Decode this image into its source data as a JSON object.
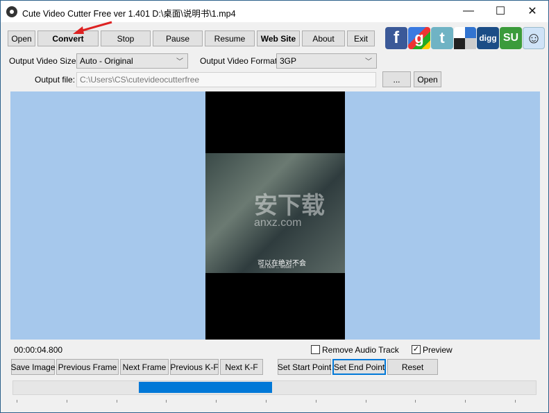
{
  "window": {
    "title": "Cute Video Cutter Free ver 1.401  D:\\桌面\\说明书\\1.mp4",
    "minimize": "—",
    "maximize": "☐",
    "close": "✕"
  },
  "toolbar": {
    "open": "Open",
    "convert": "Convert",
    "stop": "Stop",
    "pause": "Pause",
    "resume": "Resume",
    "website": "Web Site",
    "about": "About",
    "exit": "Exit"
  },
  "social": [
    {
      "name": "facebook",
      "label": "f",
      "color": "#3b5998"
    },
    {
      "name": "google",
      "label": "g",
      "color": "#dd4b39"
    },
    {
      "name": "twitter",
      "label": "t",
      "color": "#6fb3c4"
    },
    {
      "name": "delicious",
      "label": "",
      "color": "#3274d0"
    },
    {
      "name": "digg",
      "label": "digg",
      "color": "#1b4d86"
    },
    {
      "name": "stumbleupon",
      "label": "SU",
      "color": "#3b9b3b"
    },
    {
      "name": "reddit",
      "label": "☺",
      "color": "#cfe3f7"
    }
  ],
  "output": {
    "size_label": "Output Video Size:",
    "size_value": "Auto - Original",
    "format_label": "Output Video Format:",
    "format_value": "3GP",
    "file_label": "Output file:",
    "file_value": "C:\\Users\\CS\\cutevideocutterfree",
    "browse": "...",
    "open": "Open"
  },
  "video": {
    "watermark": "安下载",
    "watermark_sub": "anxz.com",
    "subtitle": "可以在绝对不会",
    "subtitle_en": "But now ... would I"
  },
  "controls": {
    "time": "00:00:04.800",
    "remove_audio": "Remove Audio Track",
    "remove_audio_checked": false,
    "preview": "Preview",
    "preview_checked": true,
    "save_image": "Save Image",
    "prev_frame": "Previous Frame",
    "next_frame": "Next Frame",
    "prev_kf": "Previous K-F",
    "next_kf": "Next K-F",
    "set_start": "Set  Start Point",
    "set_end": "Set  End Point",
    "reset": "Reset"
  },
  "timeline": {
    "selection_start_pct": 24,
    "selection_end_pct": 49.5
  }
}
